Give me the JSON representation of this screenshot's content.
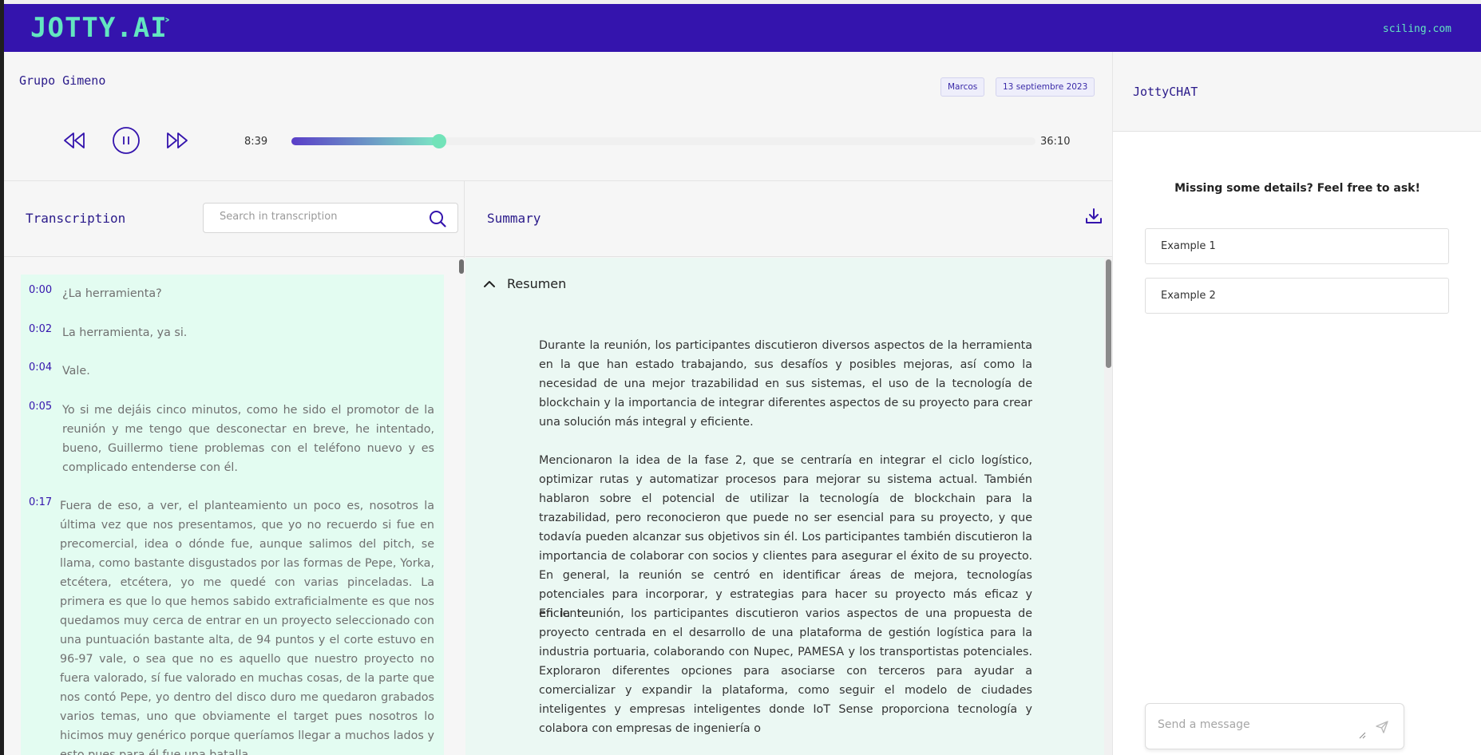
{
  "header": {
    "logo": "JOTTY.AI",
    "logo_caret": "˃",
    "site": "sciling.com"
  },
  "player": {
    "meeting_title": "Grupo Gimeno",
    "participant_tag": "Marcos",
    "date_tag": "13 septiembre 2023",
    "current_time": "8:39",
    "total_time": "36:10",
    "progress": 0.198
  },
  "transcription": {
    "title": "Transcription",
    "search_placeholder": "Search in transcription",
    "segments": [
      {
        "time": "0:00",
        "text": "¿La herramienta?"
      },
      {
        "time": "0:02",
        "text": "La herramienta, ya si."
      },
      {
        "time": "0:04",
        "text": "Vale."
      },
      {
        "time": "0:05",
        "text": "Yo si me dejáis cinco minutos, como he sido el promotor de la reunión y me tengo que desconectar en breve, he intentado, bueno, Guillermo tiene problemas con el teléfono nuevo y es complicado entenderse con él."
      },
      {
        "time": "0:17",
        "text": "Fuera de eso, a ver, el planteamiento un poco es, nosotros la última vez que nos presentamos, que yo no recuerdo si fue en precomercial, idea o dónde fue, aunque salimos del pitch, se llama, como bastante disgustados por las formas de Pepe, Yorka, etcétera, etcétera, yo me quedé con varias pinceladas. La primera es que lo que hemos sabido extraficialmente es que nos quedamos muy cerca de entrar en un proyecto seleccionado con una puntuación bastante alta, de 94 puntos y el corte estuvo en 96-97 vale, o sea que no es aquello que nuestro proyecto no fuera valorado, sí fue valorado en muchas cosas, de la parte que nos contó Pepe, yo dentro del disco duro me quedaron grabados varios temas, uno que obviamente el target pues nosotros lo hicimos muy genérico porque queríamos llegar a muchos lados y esto pues para él fue una batalla"
      }
    ]
  },
  "summary": {
    "title": "Summary",
    "section_label": "Resumen",
    "paragraphs": [
      "Durante la reunión, los participantes discutieron diversos aspectos de la herramienta en la que han estado trabajando, sus desafíos y posibles mejoras, así como la necesidad de una mejor trazabilidad en sus sistemas, el uso de la tecnología de blockchain y la importancia de integrar diferentes aspectos de su proyecto para crear una solución más integral y eficiente.",
      "Mencionaron la idea de la fase 2, que se centraría en integrar el ciclo logístico, optimizar rutas y automatizar procesos para mejorar su sistema actual. También hablaron sobre el potencial de utilizar la tecnología de blockchain para la trazabilidad, pero reconocieron que puede no ser esencial para su proyecto, y que todavía pueden alcanzar sus objetivos sin él. Los participantes también discutieron la importancia de colaborar con socios y clientes para asegurar el éxito de su proyecto. En general, la reunión se centró en identificar áreas de mejora, tecnologías potenciales para incorporar, y estrategias para hacer su proyecto más eficaz y eficiente.",
      "En la reunión, los participantes discutieron varios aspectos de una propuesta de proyecto centrada en el desarrollo de una plataforma de gestión logística para la industria portuaria, colaborando con Nupec, PAMESA y los transportistas potenciales. Exploraron diferentes opciones para asociarse con terceros para ayudar a comercializar y expandir la plataforma, como seguir el modelo de ciudades inteligentes y empresas inteligentes donde IoT Sense proporciona tecnología y colabora con empresas de ingeniería o"
    ]
  },
  "chat": {
    "title": "JottyCHAT",
    "prompt": "Missing some details? Feel free to ask!",
    "examples": [
      "Example 1",
      "Example 2"
    ],
    "message_placeholder": "Send a message"
  }
}
